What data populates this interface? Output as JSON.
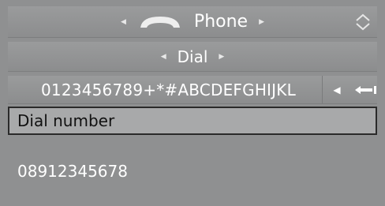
{
  "header": {
    "title": "Phone"
  },
  "submenu": {
    "title": "Dial"
  },
  "charset": {
    "characters": "0123456789+*#ABCDEFGHIJKL"
  },
  "input": {
    "label": "Dial number"
  },
  "entry": {
    "value": "08912345678"
  },
  "icons": [
    "phone-handset-icon",
    "arrow-left-icon",
    "arrow-right-icon",
    "corner-controller-icon",
    "backspace-icon"
  ]
}
